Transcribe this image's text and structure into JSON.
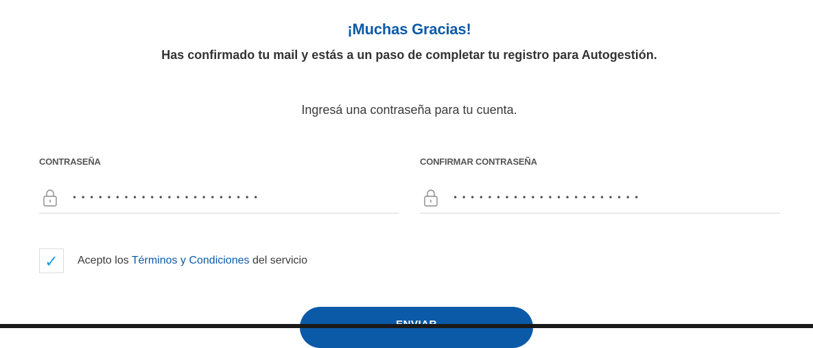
{
  "header": {
    "title": "¡Muchas Gracias!",
    "subtitle": "Has confirmado tu mail y estás a un paso de completar tu registro para Autogestión."
  },
  "instruction": "Ingresá una contraseña para tu cuenta.",
  "password_field": {
    "label": "CONTRASEÑA",
    "value": "••••••••••••••••••••••",
    "icon": "lock-icon"
  },
  "confirm_password_field": {
    "label": "CONFIRMAR CONTRASEÑA",
    "value": "••••••••••••••••••••••",
    "icon": "lock-icon"
  },
  "terms": {
    "checked": true,
    "prefix": "Acepto los",
    "link_text": "Términos y Condiciones",
    "suffix": "del servicio"
  },
  "submit_label": "ENVIAR",
  "colors": {
    "accent": "#0b5aa8",
    "check": "#1fa1e0",
    "text": "#333333"
  }
}
